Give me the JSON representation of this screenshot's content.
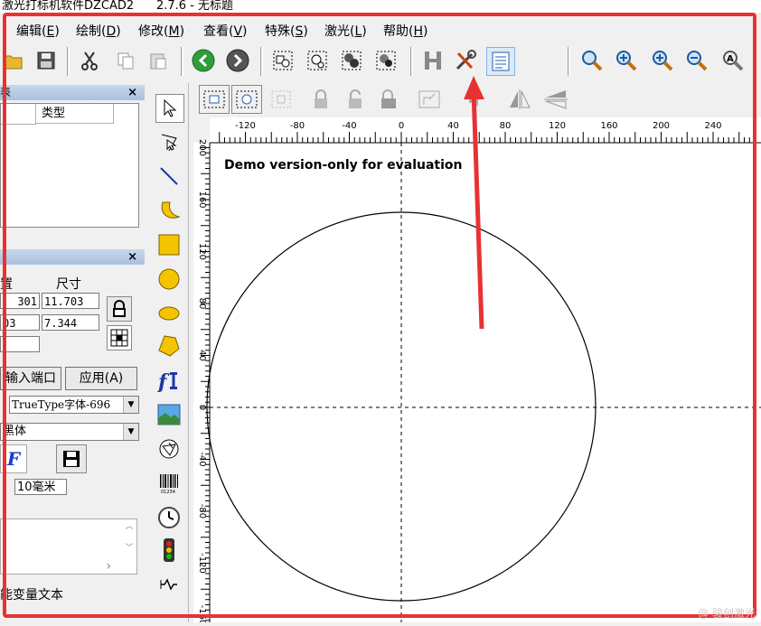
{
  "window": {
    "title": "激光打标机软件DZCAD2      2.7.6 - 无标题"
  },
  "menu": [
    {
      "label": "编辑(",
      "key": "E",
      "tail": ")"
    },
    {
      "label": "绘制(",
      "key": "D",
      "tail": ")"
    },
    {
      "label": "修改(",
      "key": "M",
      "tail": ")"
    },
    {
      "label": "查看(",
      "key": "V",
      "tail": ")"
    },
    {
      "label": "特殊(",
      "key": "S",
      "tail": ")"
    },
    {
      "label": "激光(",
      "key": "L",
      "tail": ")"
    },
    {
      "label": "帮助(",
      "key": "H",
      "tail": ")"
    }
  ],
  "object_list": {
    "header_fragment": "表",
    "close": "×",
    "column_type": "类型"
  },
  "properties": {
    "header_close": "×",
    "col_position_fragment": "置",
    "col_size": "尺寸",
    "pos_x": "301",
    "size_x": "11.703",
    "pos_y": "03",
    "size_y": "7.344",
    "pos_z": ""
  },
  "text_panel": {
    "input_port_button": "输入端口",
    "apply_button": "应用(A)",
    "font_type": "TrueType字体-696",
    "font_name": "黑体",
    "bold_glyph": "F",
    "height_value": "10毫米",
    "variable_text_fragment": "能变量文本",
    "scroll_right": "›"
  },
  "canvas": {
    "demo_text": "Demo version-only for evaluation",
    "x_ticks": [
      "-120",
      "-80",
      "-40",
      "0",
      "40",
      "80",
      "120",
      "160",
      "200",
      "240"
    ],
    "y_ticks": [
      "200",
      "160",
      "120",
      "80",
      "40",
      "0",
      "-40",
      "-80",
      "-120",
      "-160"
    ]
  },
  "colors": {
    "frame": "#e83232",
    "arrow": "#e83232"
  },
  "watermark": "@ 骏创激光"
}
